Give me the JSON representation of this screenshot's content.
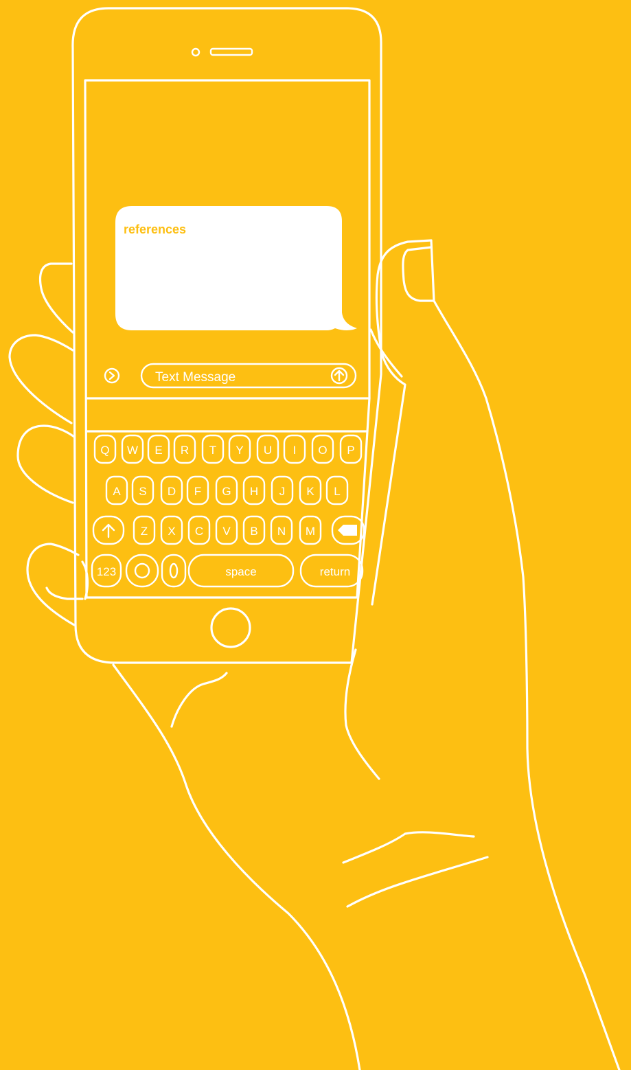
{
  "colors": {
    "background": "#FDBF12",
    "stroke": "#FFFFFF",
    "bubble_fill": "#FFFFFF",
    "bubble_text": "#FDBF12"
  },
  "message": {
    "text": "references"
  },
  "composer": {
    "placeholder": "Text Message",
    "expand_icon": "chevron-right-circle-icon",
    "send_icon": "arrow-up-circle-icon"
  },
  "keyboard": {
    "row1": [
      "Q",
      "W",
      "E",
      "R",
      "T",
      "Y",
      "U",
      "I",
      "O",
      "P"
    ],
    "row2": [
      "A",
      "S",
      "D",
      "F",
      "G",
      "H",
      "J",
      "K",
      "L"
    ],
    "row3": [
      "Z",
      "X",
      "C",
      "V",
      "B",
      "N",
      "M"
    ],
    "shift_icon": "arrow-up-icon",
    "delete_icon": "backspace-icon",
    "numbers_label": "123",
    "globe_icon": "circle-icon",
    "mic_icon": "oval-icon",
    "space_label": "space",
    "return_label": "return"
  }
}
